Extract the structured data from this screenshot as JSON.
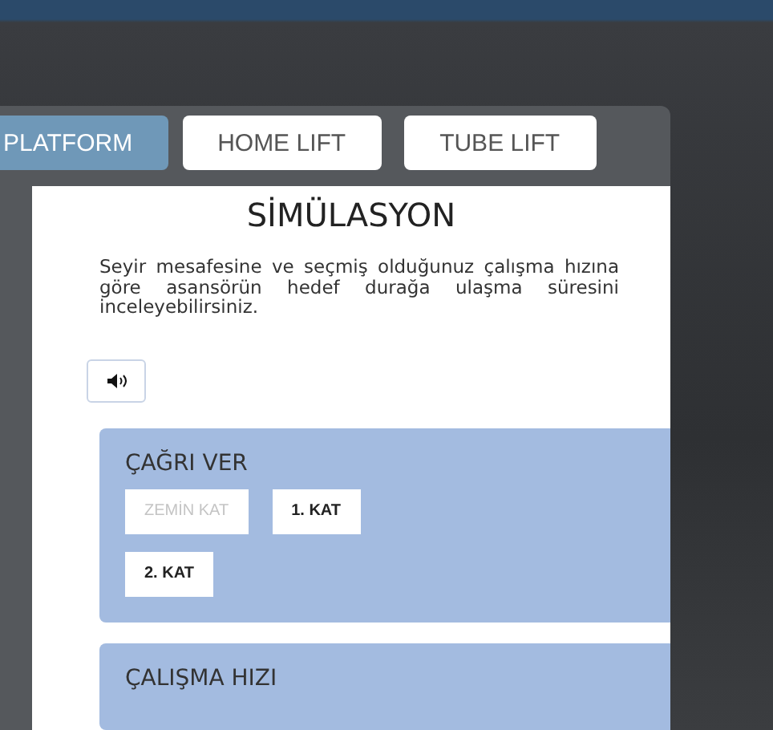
{
  "tabs": [
    {
      "label": "PLATFORM",
      "selected": true
    },
    {
      "label": "HOME LIFT",
      "selected": false
    },
    {
      "label": "TUBE LIFT",
      "selected": false
    }
  ],
  "title": "SİMÜLASYON",
  "description": "Seyir mesafesine ve seçmiş olduğunuz çalışma hızına göre asansörün hedef durağa ulaşma süresini inceleyebilirsiniz.",
  "sections": [
    {
      "heading": "ÇAĞRI VER",
      "buttons": [
        {
          "label": "ZEMİN KAT",
          "disabled": true
        },
        {
          "label": "1. KAT",
          "disabled": false
        },
        {
          "label": "2. KAT",
          "disabled": false
        }
      ]
    },
    {
      "heading": "ÇALIŞMA HIZI"
    }
  ]
}
